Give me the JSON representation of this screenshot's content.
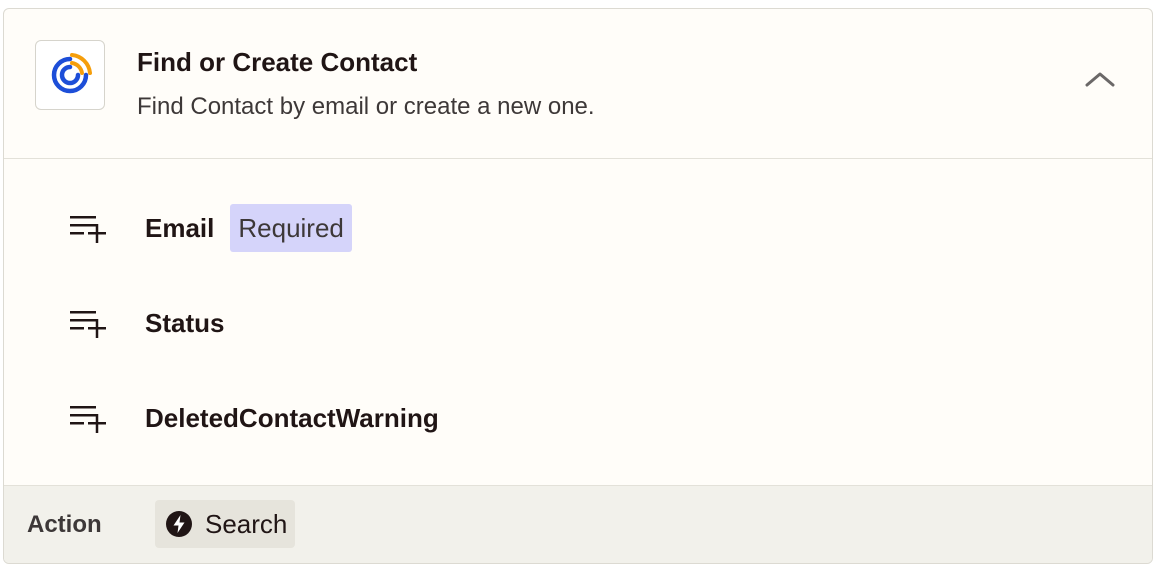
{
  "header": {
    "title": "Find or Create Contact",
    "subtitle": "Find Contact by email or create a new one.",
    "app_icon": "activecampaign-logo",
    "collapse_icon": "chevron-up-icon"
  },
  "fields": [
    {
      "label": "Email",
      "badge": "Required",
      "icon": "add-field-icon"
    },
    {
      "label": "Status",
      "icon": "add-field-icon"
    },
    {
      "label": "DeletedContactWarning",
      "icon": "add-field-icon"
    }
  ],
  "footer": {
    "label": "Action",
    "type_label": "Search",
    "type_icon": "bolt-icon"
  },
  "colors": {
    "badge_bg": "#d5d4fa",
    "footer_bg": "#f2f1eb",
    "card_bg": "#fffdf9",
    "logo_blue": "#1d4ed8",
    "logo_orange": "#f59e0b"
  }
}
